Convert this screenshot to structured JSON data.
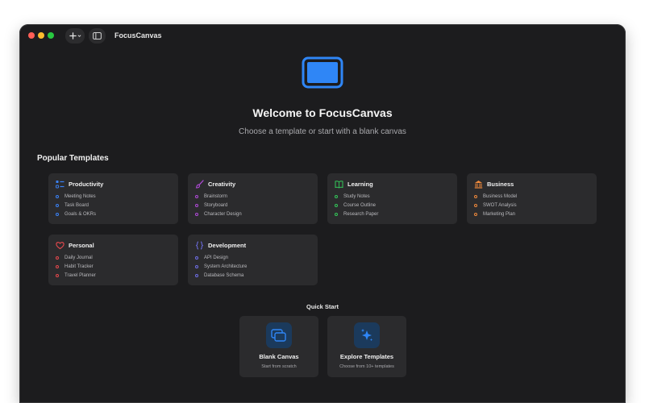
{
  "app": {
    "title": "FocusCanvas"
  },
  "hero": {
    "welcome": "Welcome to FocusCanvas",
    "subtitle": "Choose a template or start with a blank canvas"
  },
  "templates": {
    "section_title": "Popular Templates",
    "cards": [
      {
        "title": "Productivity",
        "icon": "checklist-icon",
        "color": "#3a82f7",
        "items": [
          "Meeting Notes",
          "Task Board",
          "Goals & OKRs"
        ]
      },
      {
        "title": "Creativity",
        "icon": "paintbrush-icon",
        "color": "#b04ad8",
        "items": [
          "Brainstorm",
          "Storyboard",
          "Character Design"
        ]
      },
      {
        "title": "Learning",
        "icon": "book-icon",
        "color": "#34c759",
        "items": [
          "Study Notes",
          "Course Outline",
          "Research Paper"
        ]
      },
      {
        "title": "Business",
        "icon": "building-icon",
        "color": "#f08a3c",
        "items": [
          "Business Model",
          "SWOT Analysis",
          "Marketing Plan"
        ]
      },
      {
        "title": "Personal",
        "icon": "heart-icon",
        "color": "#e5484d",
        "items": [
          "Daily Journal",
          "Habit Tracker",
          "Travel Planner"
        ]
      },
      {
        "title": "Development",
        "icon": "curly-braces-icon",
        "color": "#6e6ee6",
        "items": [
          "API Design",
          "System Architecture",
          "Database Schema"
        ]
      }
    ]
  },
  "quick_start": {
    "title": "Quick Start",
    "blank": {
      "label": "Blank Canvas",
      "sub": "Start from scratch",
      "icon": "canvas-stack-icon"
    },
    "explore": {
      "label": "Explore Templates",
      "sub": "Choose from 10+ templates",
      "icon": "sparkles-icon"
    }
  },
  "colors": {
    "accent": "#2f86f6",
    "background": "#1c1c1e",
    "card": "#2b2b2d"
  }
}
